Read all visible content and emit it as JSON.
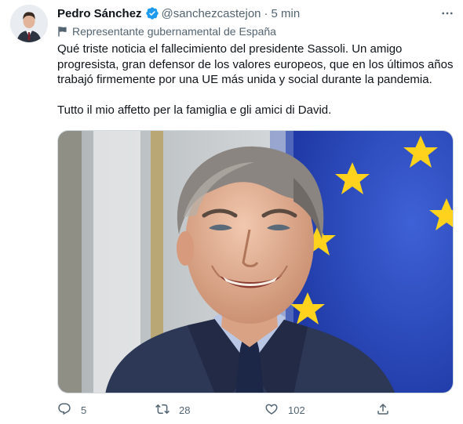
{
  "author": {
    "name": "Pedro Sánchez",
    "handle": "@sanchezcastejon",
    "separator": "·",
    "time": "5 min",
    "label": "Representante gubernamental de España"
  },
  "tweet": {
    "paragraph1": "Qué triste noticia el fallecimiento del presidente Sassoli. Un amigo progresista, gran defensor de los valores europeos, que en los últimos años trabajó firmemente por una UE más unida y social durante la pandemia.",
    "paragraph2": "Tutto il mio affetto per la famiglia e gli amici di David."
  },
  "stats": {
    "replies": "5",
    "retweets": "28",
    "likes": "102"
  },
  "icons": {
    "verified": "verified-badge-icon",
    "more": "more-options-icon",
    "label": "government-flag-icon",
    "reply": "reply-icon",
    "retweet": "retweet-icon",
    "like": "like-icon",
    "share": "share-icon"
  },
  "colors": {
    "text": "#0f1419",
    "secondary": "#536471",
    "verified": "#1d9bf0",
    "eu_blue": "#2f4fc9",
    "eu_star": "#ffd21e"
  }
}
